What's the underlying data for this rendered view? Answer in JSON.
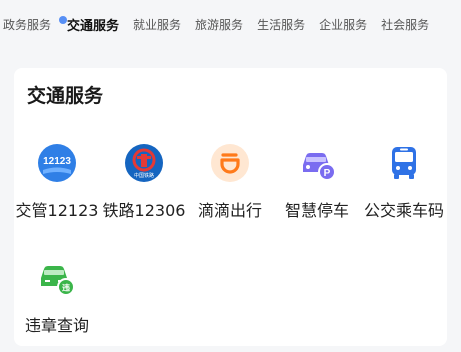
{
  "tabs": [
    {
      "label": "政务服务",
      "active": false
    },
    {
      "label": "交通服务",
      "active": true
    },
    {
      "label": "就业服务",
      "active": false
    },
    {
      "label": "旅游服务",
      "active": false
    },
    {
      "label": "生活服务",
      "active": false
    },
    {
      "label": "企业服务",
      "active": false
    },
    {
      "label": "社会服务",
      "active": false
    }
  ],
  "section": {
    "title": "交通服务",
    "services": [
      {
        "label": "交管12123",
        "icon": "traffic-12123-icon",
        "icon_text": "12123",
        "color": "#2f7fe6"
      },
      {
        "label": "铁路12306",
        "icon": "railway-12306-icon",
        "icon_text": "中国铁路",
        "color": "#1565c0"
      },
      {
        "label": "滴滴出行",
        "icon": "didi-icon",
        "color": "#ff7a1a"
      },
      {
        "label": "智慧停车",
        "icon": "smart-parking-icon",
        "color": "#7a6cf0"
      },
      {
        "label": "公交乘车码",
        "icon": "bus-icon",
        "color": "#2f72e6"
      },
      {
        "label": "违章查询",
        "icon": "violation-car-icon",
        "icon_text": "违",
        "color": "#3bb54a"
      }
    ]
  }
}
